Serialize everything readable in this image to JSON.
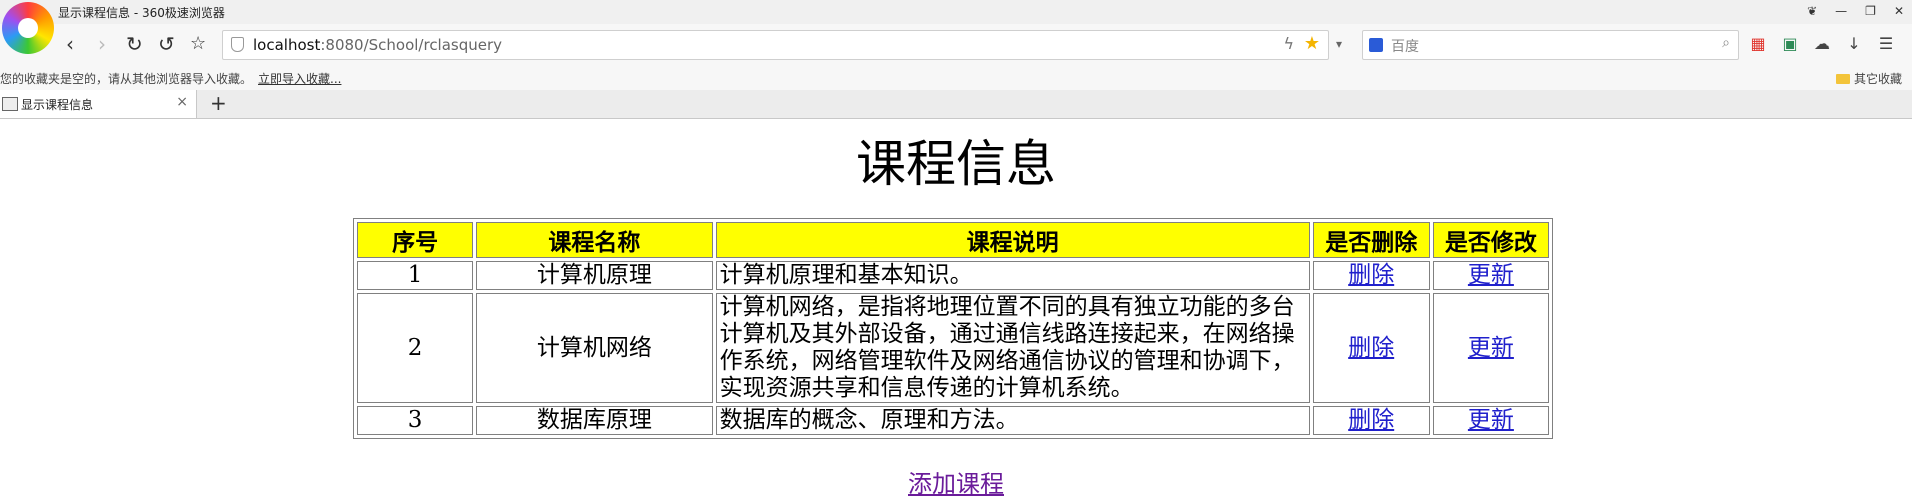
{
  "window": {
    "title": "显示课程信息 - 360极速浏览器"
  },
  "address_bar": {
    "url_host": "localhost",
    "url_rest": ":8080/School/rclasquery"
  },
  "search_bar": {
    "placeholder": "百度"
  },
  "bookmarks_bar": {
    "message": "您的收藏夹是空的，请从其他浏览器导入收藏。",
    "import_link": "立即导入收藏...",
    "other_folder": "其它收藏"
  },
  "tab": {
    "label": "显示课程信息",
    "close": "×",
    "new": "+"
  },
  "page": {
    "title": "课程信息",
    "table": {
      "headers": [
        "序号",
        "课程名称",
        "课程说明",
        "是否删除",
        "是否修改"
      ],
      "rows": [
        {
          "id": "1",
          "name": "计算机原理",
          "desc": "计算机原理和基本知识。",
          "delete": "删除",
          "update": "更新"
        },
        {
          "id": "2",
          "name": "计算机网络",
          "desc": "计算机网络，是指将地理位置不同的具有独立功能的多台计算机及其外部设备，通过通信线路连接起来，在网络操作系统，网络管理软件及网络通信协议的管理和协调下，实现资源共享和信息传递的计算机系统。",
          "delete": "删除",
          "update": "更新"
        },
        {
          "id": "3",
          "name": "数据库原理",
          "desc": "数据库的概念、原理和方法。",
          "delete": "删除",
          "update": "更新"
        }
      ]
    },
    "add_link": "添加课程"
  },
  "colors": {
    "header_bg": "#ffff00",
    "link": "#2020cc",
    "visited_link": "#6a1b9a"
  },
  "icons": [
    "browser-logo-icon",
    "back-icon",
    "forward-icon",
    "reload-icon",
    "undo-icon",
    "favorite-icon",
    "shield-icon",
    "lightning-icon",
    "star-icon",
    "search-engine-icon",
    "search-icon",
    "apps-icon",
    "image-icon",
    "cloud-icon",
    "download-icon",
    "menu-icon",
    "folder-icon",
    "favicon-icon",
    "close-icon"
  ]
}
